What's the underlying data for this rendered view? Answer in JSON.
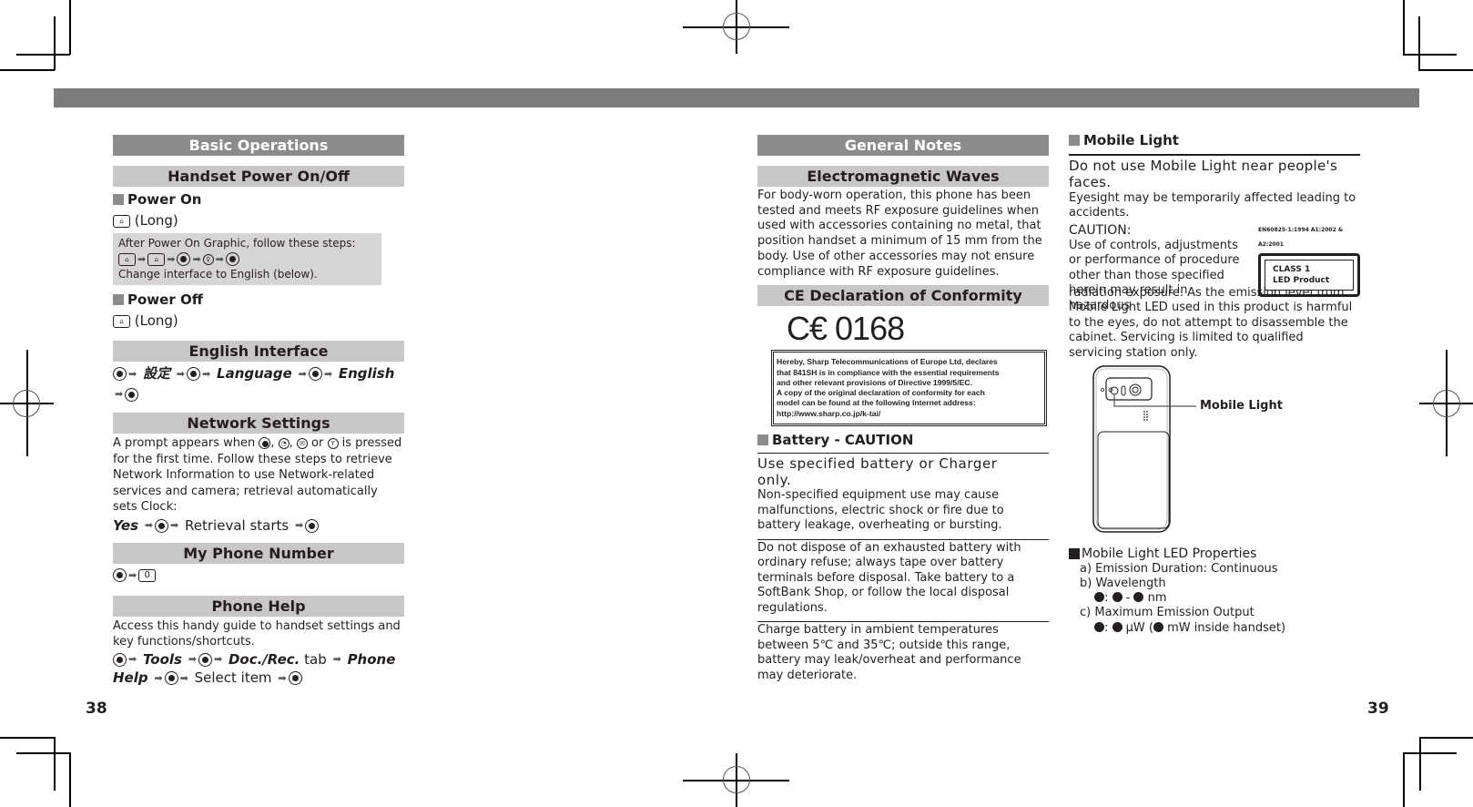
{
  "left_page": {
    "page_number": "38",
    "section_title": "Basic Operations",
    "power": {
      "title": "Handset Power On/Off",
      "power_on": {
        "heading": "Power On",
        "key_icon": "power-end-key-icon",
        "action": "(Long)",
        "note_line1": "After Power On Graphic, follow these steps:",
        "note_line3": "Change interface to English (below)."
      },
      "power_off": {
        "heading": "Power Off",
        "key_icon": "power-end-key-icon",
        "action": "(Long)"
      }
    },
    "english": {
      "title": "English Interface",
      "step1": "設定",
      "step2": "Language",
      "step3": "English"
    },
    "network": {
      "title": "Network Settings",
      "text_a": "A prompt appears when",
      "text_b": "or",
      "text_c": "is pressed",
      "text_rest": "for the first time. Follow these steps to retrieve Network Information to use Network-related services and camera; retrieval automatically sets Clock:",
      "step_yes": "Yes",
      "step_retrieval": "Retrieval starts"
    },
    "my_number": {
      "title": "My Phone Number",
      "key_label": "0"
    },
    "help": {
      "title": "Phone Help",
      "text": "Access this handy guide to handset settings and key functions/shortcuts.",
      "tools": "Tools",
      "docrec": "Doc./Rec.",
      "tab": "tab",
      "phone": "Phone",
      "help": "Help",
      "select": "Select item"
    }
  },
  "right_page": {
    "page_number": "39",
    "section_title": "General Notes",
    "em": {
      "title": "Electromagnetic Waves",
      "text": "For body-worn operation, this phone has been tested and meets RF exposure guidelines when used with accessories containing no metal, that position handset a minimum of 15 mm from the body. Use of other accessories may not ensure compliance with RF exposure guidelines."
    },
    "ce": {
      "title": "CE Declaration of Conformity",
      "mark": "C€ 0168",
      "box_text": [
        "Hereby, Sharp Telecommunications of Europe Ltd, declares",
        "that 841SH is in compliance with the essential requirements",
        "and other relevant provisions of Directive 1999/5/EC.",
        "A copy of the original declaration of conformity for each",
        "model can be found at the following Internet address:",
        "http://www.sharp.co.jp/k-tai/"
      ]
    },
    "battery": {
      "heading": "Battery - CAUTION",
      "warning": "Use specified battery or Charger only.",
      "para1": "Non-specified equipment use may cause malfunctions, electric shock or fire due to battery leakage, overheating or bursting.",
      "para2": "Do not dispose of an exhausted battery with ordinary refuse; always tape over battery terminals before disposal. Take battery to a SoftBank Shop, or follow the local disposal regulations.",
      "para3": "Charge battery in ambient temperatures between 5℃ and 35℃; outside this range, battery may leak/overheat and performance may deteriorate."
    },
    "mobile_light": {
      "heading": "Mobile Light",
      "warning": "Do not use Mobile Light near people's faces.",
      "sub": "Eyesight may be temporarily affected leading to accidents.",
      "caution_label": "CAUTION:",
      "caution_text_a": "Use of controls, adjustments or performance of procedure other than those specified herein may result in hazardous",
      "caution_text_b": "radiation exposure. As the emission level from Mobile Light LED used in this product is harmful to the eyes, do not attempt to disassemble the cabinet. Servicing is limited to qualified servicing station only.",
      "led_standard": "EN60825-1:1994  A1:2002 & A2:2001",
      "led_class": "CLASS 1",
      "led_product": "LED Product",
      "figure_label": "Mobile Light",
      "props_heading": "Mobile Light LED Properties",
      "prop_a": "a) Emission Duration: Continuous",
      "prop_b": "b) Wavelength",
      "prop_b_value": "nm",
      "prop_c": "c) Maximum Emission Output",
      "prop_c_unit": "μW (",
      "prop_c_suffix": "mW inside handset)"
    }
  }
}
